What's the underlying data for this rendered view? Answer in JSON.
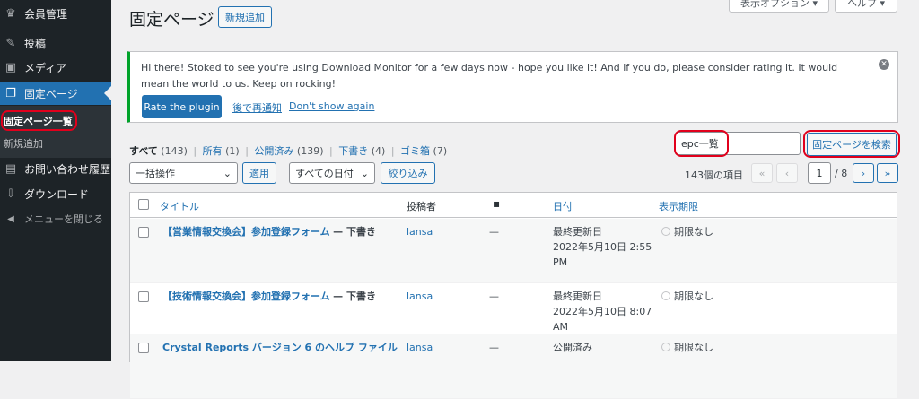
{
  "sidebar": {
    "items": [
      {
        "label": "会員管理",
        "icon": "groups-icon",
        "glyph": "♛"
      },
      {
        "label": "投稿",
        "icon": "pin-icon",
        "glyph": "✎"
      },
      {
        "label": "メディア",
        "icon": "media-icon",
        "glyph": "▣"
      },
      {
        "label": "固定ページ",
        "icon": "page-icon",
        "glyph": "❐"
      },
      {
        "label": "お問い合わせ履歴",
        "icon": "table-icon",
        "glyph": "▤"
      },
      {
        "label": "ダウンロード",
        "icon": "download-icon",
        "glyph": "⇩"
      },
      {
        "label": "メニューを閉じる",
        "icon": "collapse-icon",
        "glyph": "◀"
      }
    ],
    "submenu": [
      {
        "label": "固定ページ一覧"
      },
      {
        "label": "新規追加"
      }
    ]
  },
  "header": {
    "title": "固定ページ",
    "add_new": "新規追加",
    "screen_options": "表示オプション ▾",
    "help": "ヘルプ ▾"
  },
  "notice": {
    "text": "Hi there! Stoked to see you're using Download Monitor for a few days now - hope you like it! And if you do, please consider rating it. It would mean the world to us. Keep on rocking!",
    "rate_button": "Rate the plugin",
    "remind_later": "後で再通知",
    "dont_show": "Don't show again"
  },
  "filters": {
    "all": "すべて",
    "all_count": "(143)",
    "mine": "所有",
    "mine_count": "(1)",
    "published": "公開済み",
    "published_count": "(139)",
    "drafts": "下書き",
    "drafts_count": "(4)",
    "trash": "ゴミ箱",
    "trash_count": "(7)",
    "sep": "|"
  },
  "search": {
    "value": "epc一覧",
    "button": "固定ページを検索"
  },
  "toolbar": {
    "bulk_action": "一括操作",
    "apply": "適用",
    "date_filter": "すべての日付",
    "filter_button": "絞り込み"
  },
  "pagination": {
    "items": "143個の項目",
    "first": "«",
    "prev": "‹",
    "current": "1",
    "total": "/ 8",
    "next": "›",
    "last": "»"
  },
  "table": {
    "columns": {
      "title": "タイトル",
      "author": "投稿者",
      "date": "日付",
      "expiry": "表示期限"
    },
    "rows": [
      {
        "title": "【営業情報交換会】参加登録フォーム",
        "state": "— 下書き",
        "author": "lansa",
        "comments": "—",
        "date_status": "最終更新日",
        "date_line1": "2022年5月10日 2:55",
        "date_line2": "PM",
        "expiry": "期限なし"
      },
      {
        "title": "【技術情報交換会】参加登録フォーム",
        "state": "— 下書き",
        "author": "lansa",
        "comments": "—",
        "date_status": "最終更新日",
        "date_line1": "2022年5月10日 8:07",
        "date_line2": "AM",
        "expiry": "期限なし"
      },
      {
        "title": "Crystal Reports バージョン 6 のヘルプ ファイル",
        "state": "",
        "author": "lansa",
        "comments": "—",
        "date_status": "公開済み",
        "date_line1": "",
        "date_line2": "",
        "expiry": "期限なし"
      }
    ]
  },
  "colors": {
    "sidebar_bg": "#1d2327",
    "accent": "#2271b1",
    "notice_border": "#00a32a",
    "highlight": "#e1001c"
  }
}
